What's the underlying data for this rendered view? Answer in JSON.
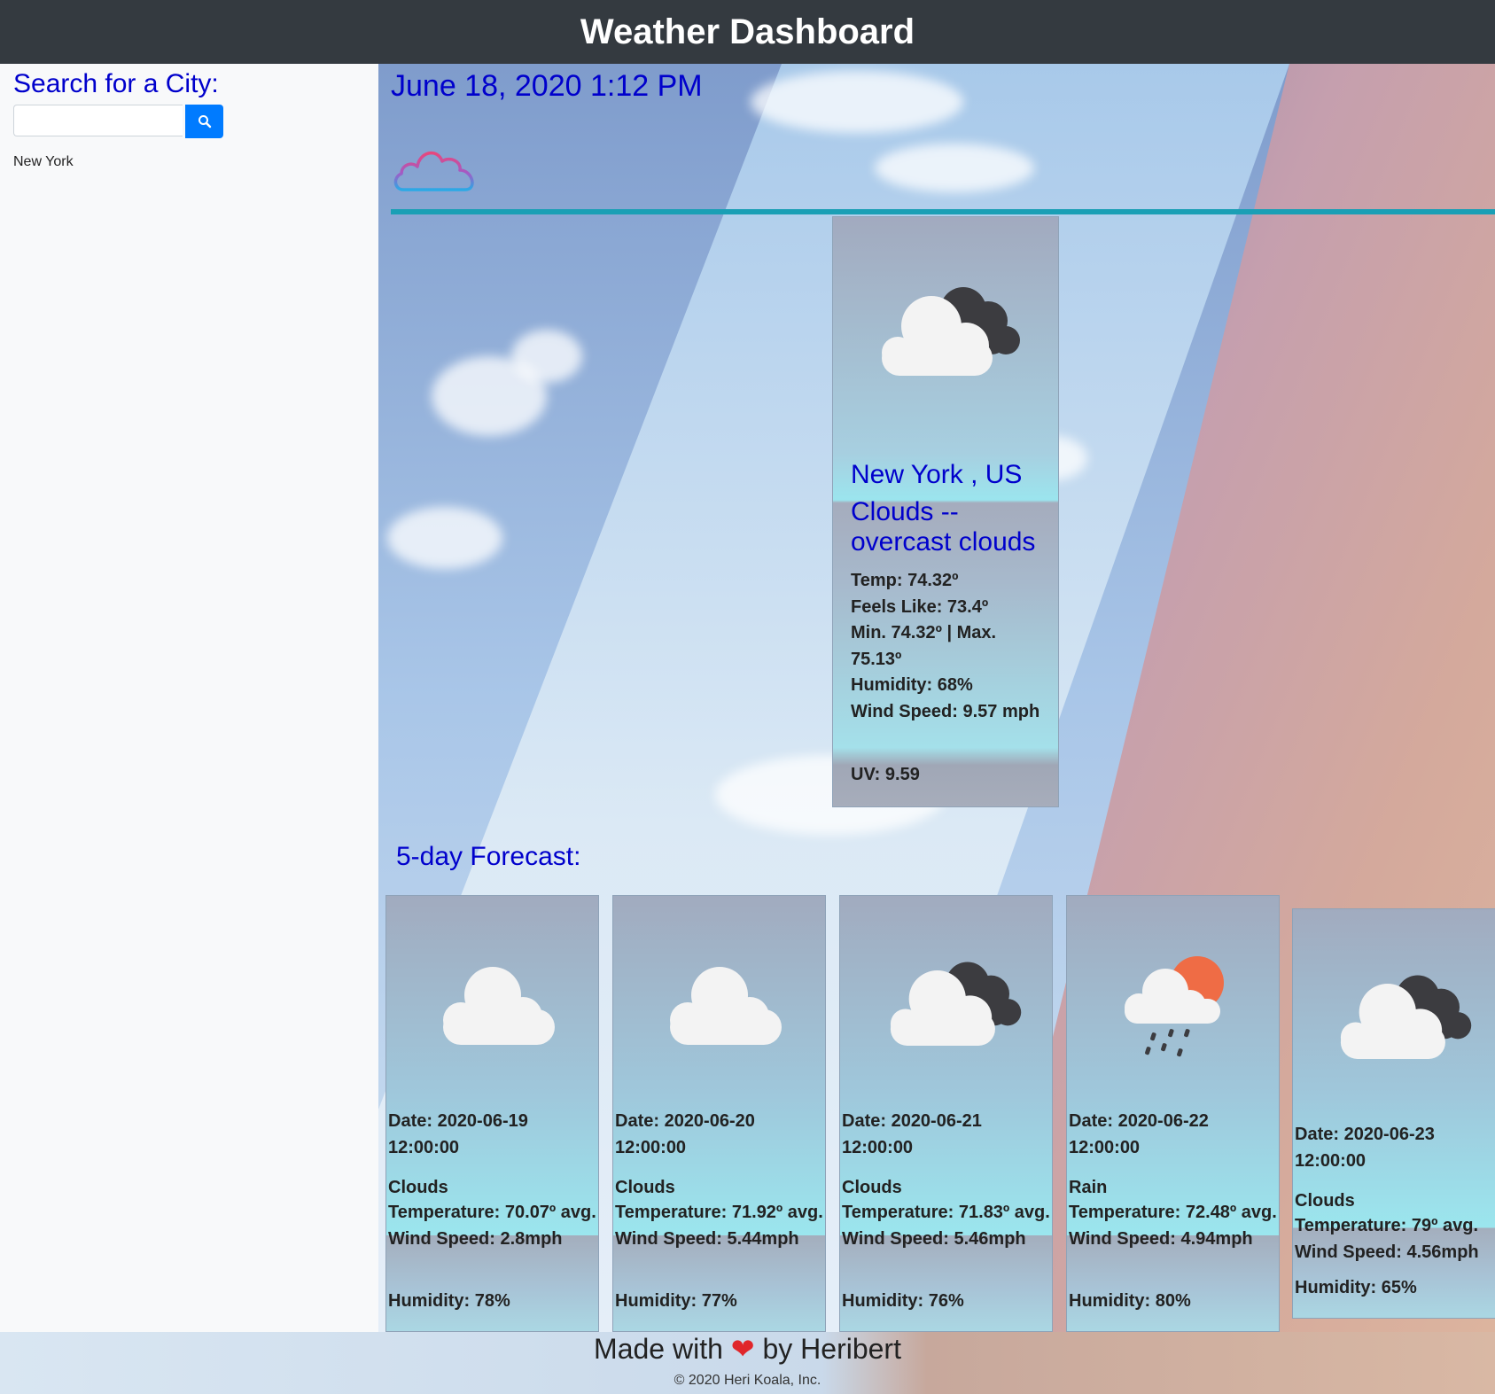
{
  "header": {
    "title": "Weather Dashboard"
  },
  "sidebar": {
    "search_heading": "Search for a City:",
    "search_value": "",
    "search_button_icon": "search-icon",
    "history": [
      "New York"
    ]
  },
  "current": {
    "datetime": "June 18, 2020 1:12 PM",
    "icon": "cloud-outline-icon",
    "city": "New York , US",
    "condition": "Clouds -- overcast clouds",
    "condition_icon": "overcast-clouds-icon",
    "temp": "Temp: 74.32º",
    "feels_like": "Feels Like: 73.4º",
    "min_max": "Min. 74.32º | Max. 75.13º",
    "humidity": "Humidity: 68%",
    "wind": "Wind Speed: 9.57 mph",
    "uv": "UV: 9.59"
  },
  "forecast": {
    "heading": "5-day Forecast:",
    "days": [
      {
        "date": "Date: 2020-06-19 12:00:00",
        "icon": "cloud-icon",
        "condition": "Clouds",
        "temperature": "Temperature: 70.07º avg.",
        "wind": "Wind Speed: 2.8mph",
        "humidity": "Humidity: 78%"
      },
      {
        "date": "Date: 2020-06-20 12:00:00",
        "icon": "cloud-icon",
        "condition": "Clouds",
        "temperature": "Temperature: 71.92º avg.",
        "wind": "Wind Speed: 5.44mph",
        "humidity": "Humidity: 77%"
      },
      {
        "date": "Date: 2020-06-21 12:00:00",
        "icon": "overcast-clouds-icon",
        "condition": "Clouds",
        "temperature": "Temperature: 71.83º avg.",
        "wind": "Wind Speed: 5.46mph",
        "humidity": "Humidity: 76%"
      },
      {
        "date": "Date: 2020-06-22 12:00:00",
        "icon": "rain-sun-icon",
        "condition": "Rain",
        "temperature": "Temperature: 72.48º avg.",
        "wind": "Wind Speed: 4.94mph",
        "humidity": "Humidity: 80%"
      },
      {
        "date": "Date: 2020-06-23 12:00:00",
        "icon": "overcast-clouds-icon",
        "condition": "Clouds",
        "temperature": "Temperature: 79º avg.",
        "wind": "Wind Speed: 4.56mph",
        "humidity": "Humidity: 65%"
      }
    ]
  },
  "footer": {
    "made_prefix": "Made with",
    "made_heart": "❤",
    "made_suffix": "by Heribert",
    "copyright": "© 2020 Heri Koala, Inc."
  },
  "colors": {
    "header_bg": "#343a40",
    "heading_blue": "#0000cc",
    "search_button": "#007bff",
    "divider": "#1a9fb5"
  }
}
